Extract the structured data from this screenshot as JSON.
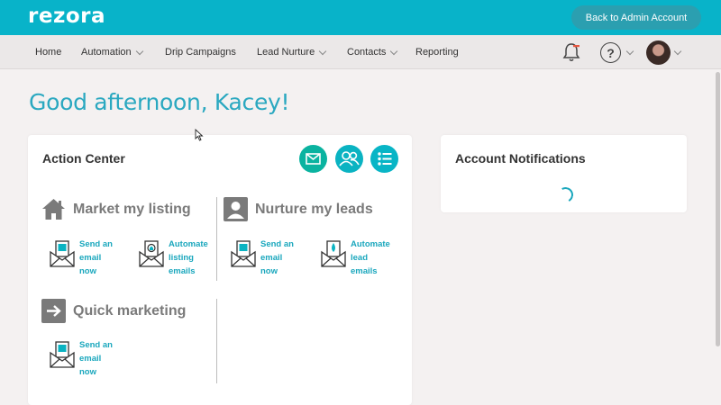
{
  "app": {
    "logo": "rezora",
    "admin_button": "Back to Admin Account"
  },
  "nav": {
    "items": [
      {
        "label": "Home",
        "dropdown": false
      },
      {
        "label": "Automation",
        "dropdown": true
      },
      {
        "label": "Drip Campaigns",
        "dropdown": false
      },
      {
        "label": "Lead Nurture",
        "dropdown": true
      },
      {
        "label": "Contacts",
        "dropdown": true
      },
      {
        "label": "Reporting",
        "dropdown": false
      }
    ],
    "help_glyph": "?"
  },
  "greeting": "Good afternoon, Kacey!",
  "action_center": {
    "title": "Action Center",
    "sections": [
      {
        "title": "Market my listing",
        "icon": "house-icon",
        "actions": [
          {
            "lines": [
              "Send an",
              "email",
              "now"
            ],
            "icon": "envelope-listing-icon"
          },
          {
            "lines": [
              "Automate",
              "listing",
              "emails"
            ],
            "icon": "envelope-automate-listing-icon"
          }
        ]
      },
      {
        "title": "Nurture my leads",
        "icon": "person-icon",
        "actions": [
          {
            "lines": [
              "Send an",
              "email",
              "now"
            ],
            "icon": "envelope-lead-icon"
          },
          {
            "lines": [
              "Automate",
              "lead",
              "emails"
            ],
            "icon": "envelope-drop-icon"
          }
        ]
      },
      {
        "title": "Quick marketing",
        "icon": "arrow-right-icon",
        "actions": [
          {
            "lines": [
              "Send an",
              "email",
              "now"
            ],
            "icon": "envelope-quick-icon"
          }
        ]
      }
    ]
  },
  "notifications": {
    "title": "Account Notifications"
  },
  "colors": {
    "brand": "#08b3c9",
    "accent_text": "#1aa7bd",
    "greeting": "#2aa8c0",
    "teal_button": "#0ab3a0",
    "bell_badge": "#e8563f"
  }
}
